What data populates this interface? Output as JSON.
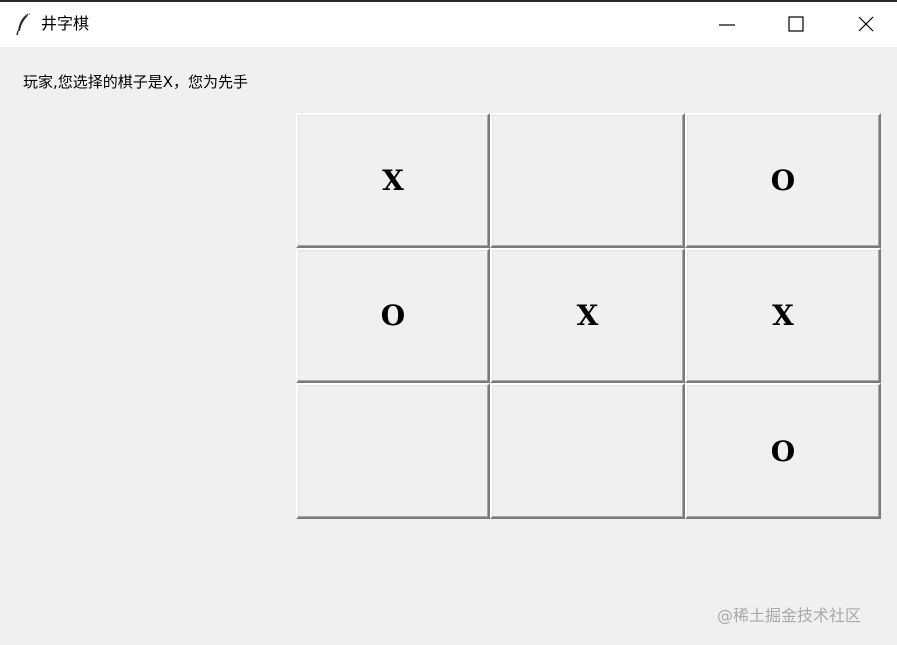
{
  "window": {
    "title": "井字棋",
    "icon": "feather-icon"
  },
  "status": {
    "message": "玩家,您选择的棋子是X，您为先手"
  },
  "board": {
    "cells": [
      "X",
      "",
      "O",
      "O",
      "X",
      "X",
      "",
      "",
      "O"
    ]
  },
  "watermark": {
    "text": "@稀土掘金技术社区"
  }
}
